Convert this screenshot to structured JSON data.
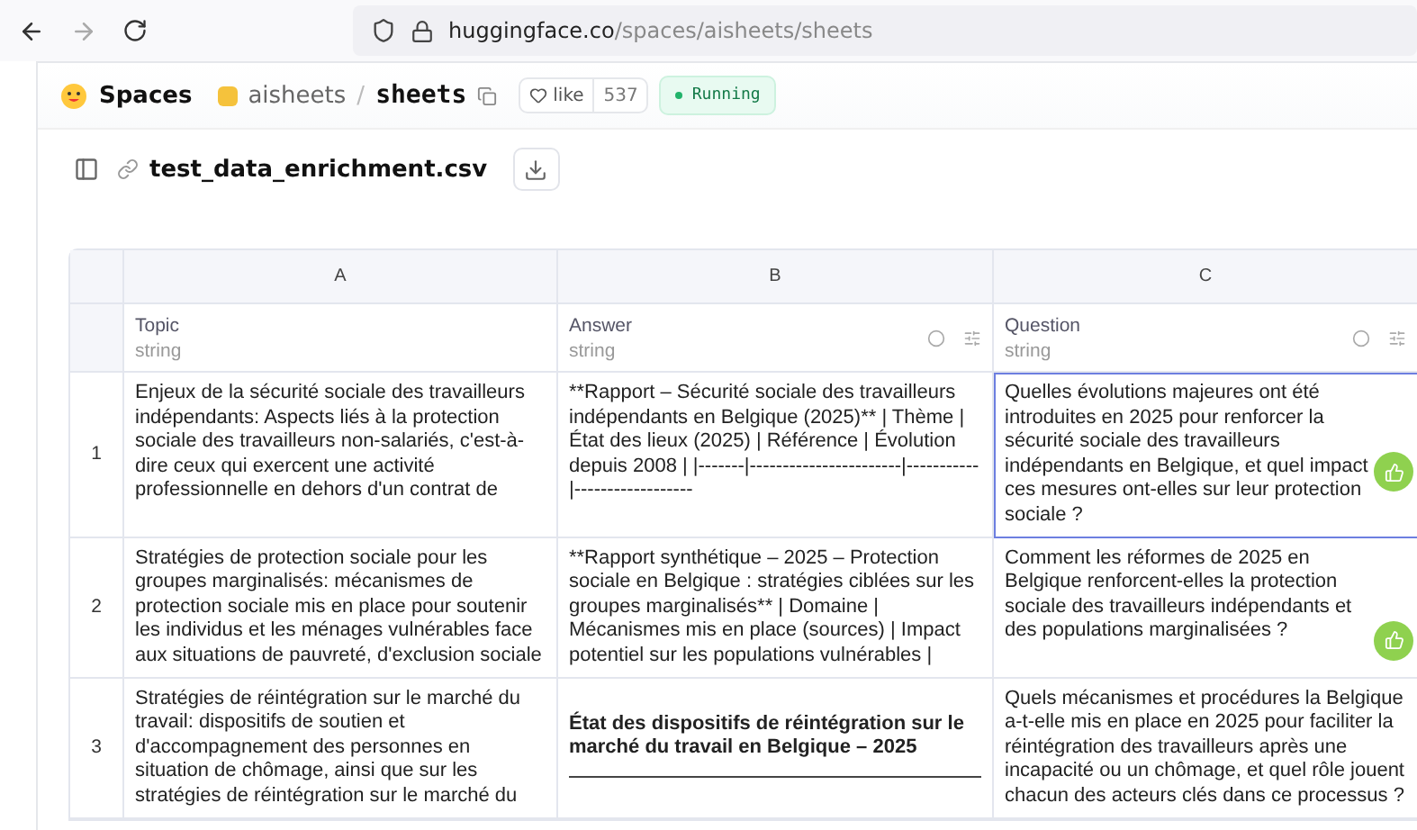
{
  "browser": {
    "url_host": "huggingface.co",
    "url_path": "/spaces/aisheets/sheets"
  },
  "header": {
    "brand": "Spaces",
    "owner": "aisheets",
    "separator": "/",
    "repo": "sheets",
    "like_label": "like",
    "like_count": "537",
    "status": "Running"
  },
  "file": {
    "name": "test_data_enrichment.csv"
  },
  "columns": [
    {
      "letter": "A",
      "name": "Topic",
      "type": "string",
      "tools": false
    },
    {
      "letter": "B",
      "name": "Answer",
      "type": "string",
      "tools": true
    },
    {
      "letter": "C",
      "name": "Question",
      "type": "string",
      "tools": true
    }
  ],
  "rows": [
    {
      "number": "1",
      "cells": [
        {
          "text": "Enjeux de la sécurité sociale des travailleurs indépendants: Aspects liés à la protection sociale des travailleurs non-salariés, c'est-à-dire ceux qui exercent une activité professionnelle en dehors d'un contrat de",
          "selected": false,
          "liked": false
        },
        {
          "text": "**Rapport – Sécurité sociale des travailleurs indépendants en Belgique (2025)** | Thème | État des lieux (2025) | Référence | Évolution depuis 2008 | |-------|-----------------------|-----------|------------------",
          "selected": false,
          "liked": false
        },
        {
          "text": "Quelles évolutions majeures ont été introduites en 2025 pour renforcer la sécurité sociale des travailleurs indépendants en Belgique, et quel impact ces mesures ont-elles sur leur protection sociale ?",
          "selected": true,
          "liked": true
        }
      ]
    },
    {
      "number": "2",
      "cells": [
        {
          "text": "Stratégies de protection sociale pour les groupes marginalisés: mécanismes de protection sociale mis en place pour soutenir les individus et les ménages vulnérables face aux situations de pauvreté, d'exclusion sociale",
          "selected": false,
          "liked": false
        },
        {
          "text": "**Rapport synthétique – 2025 – Protection sociale en Belgique : stratégies ciblées sur les groupes marginalisés** | Domaine | Mécanismes mis en place (sources) | Impact potentiel sur les populations vulnérables |",
          "selected": false,
          "liked": false
        },
        {
          "text": "Comment les réformes de 2025 en Belgique renforcent-elles la protection sociale des travailleurs indépendants et des populations marginalisées ?",
          "selected": false,
          "liked": true
        }
      ]
    },
    {
      "number": "3",
      "cells": [
        {
          "text": "Stratégies de réintégration sur le marché du travail: dispositifs de soutien et d'accompagnement des personnes en situation de chômage, ainsi que sur les stratégies de réintégration sur le marché du",
          "selected": false,
          "liked": false
        },
        {
          "text": "État des dispositifs de réintégration sur le marché du travail en Belgique – 2025",
          "kind": "heading",
          "selected": false,
          "liked": false
        },
        {
          "text": "Quels mécanismes et procédures la Belgique a-t-elle mis en place en 2025 pour faciliter la réintégration des travailleurs après une incapacité ou un chômage, et quel rôle jouent chacun des acteurs clés dans ce processus ?",
          "selected": false,
          "liked": false
        }
      ]
    }
  ]
}
